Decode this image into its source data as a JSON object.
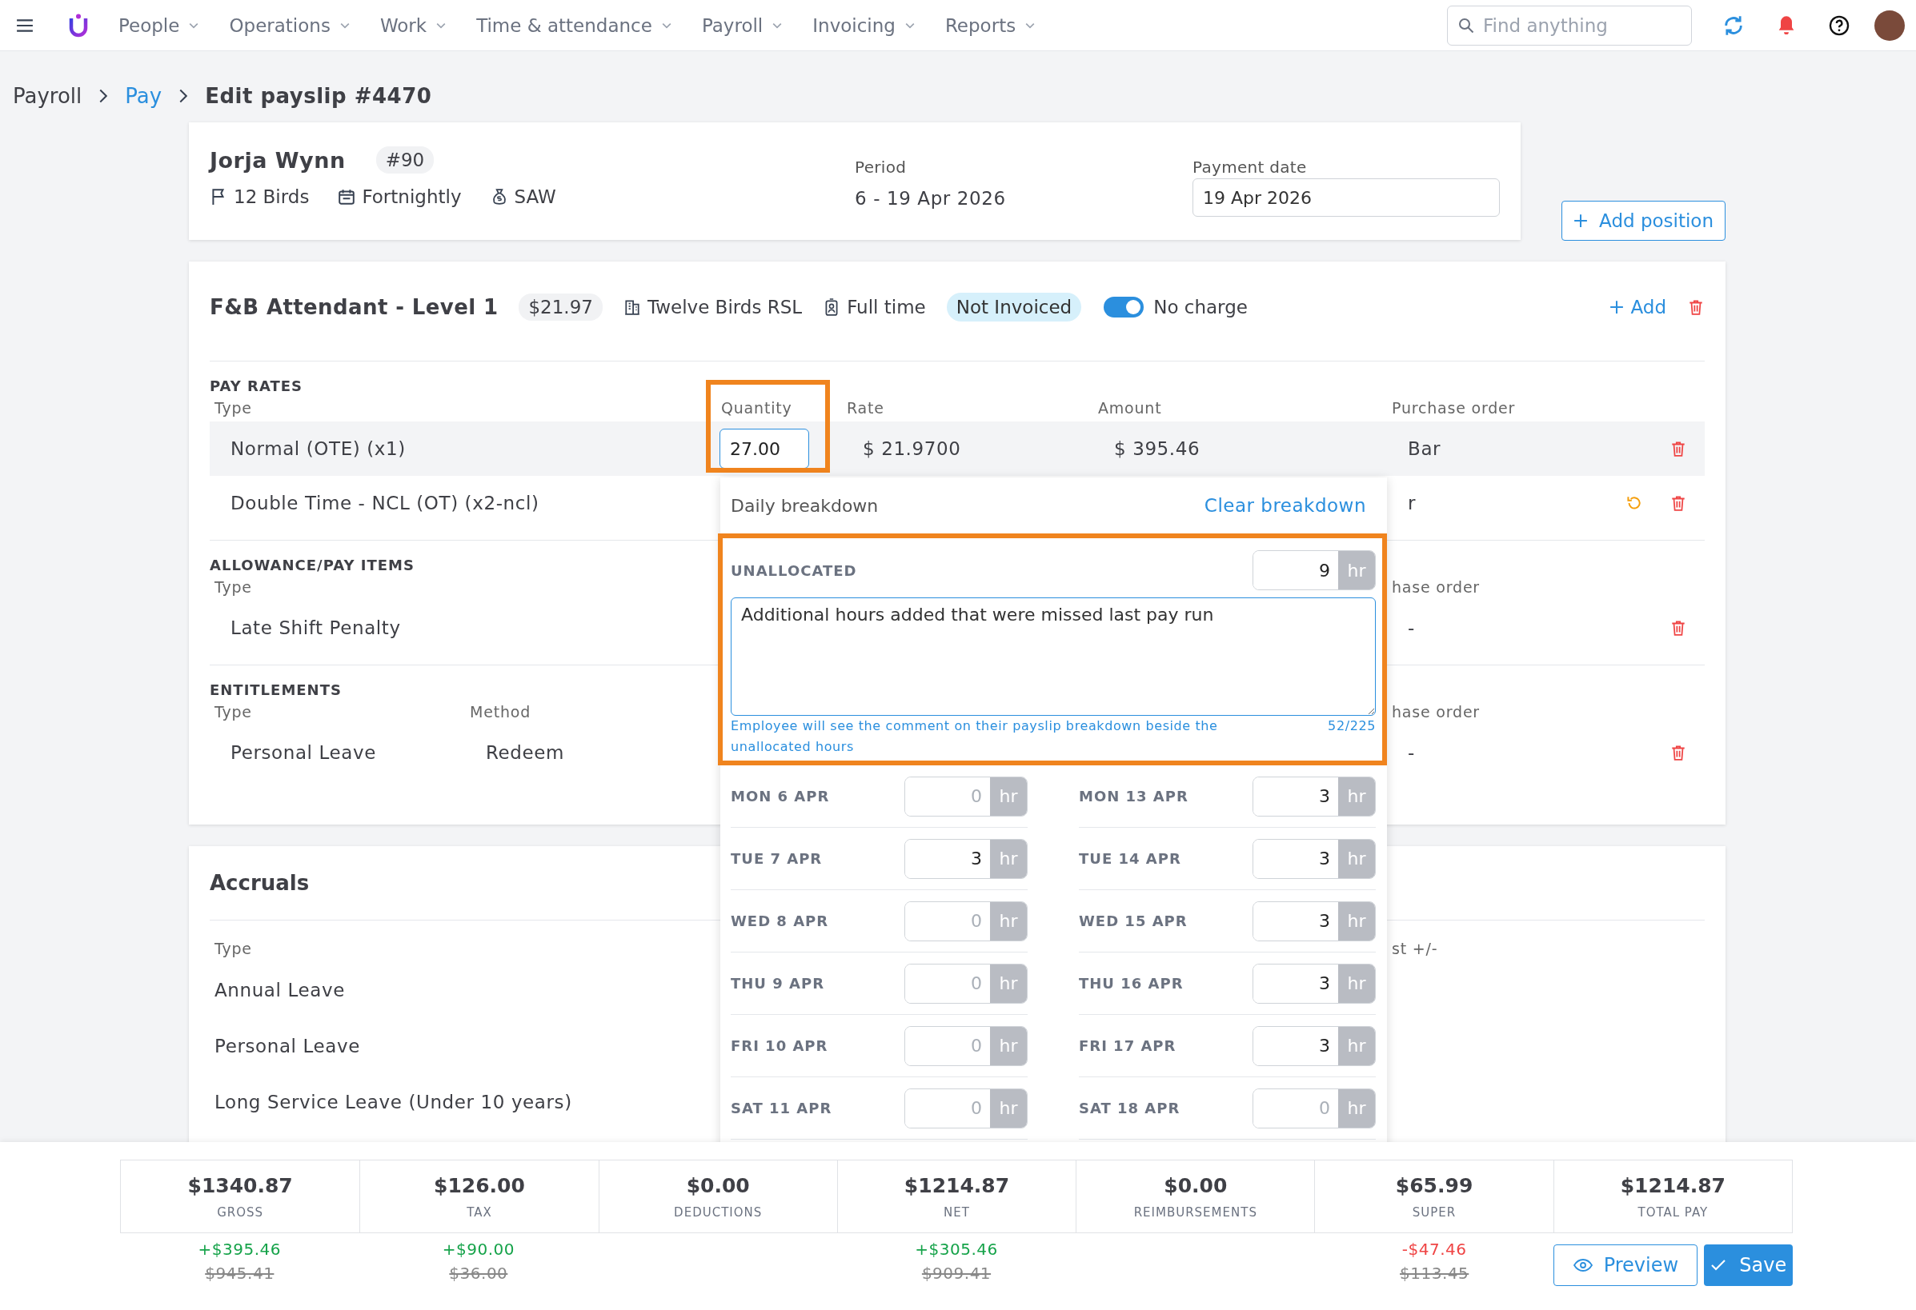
{
  "nav": {
    "items": [
      {
        "label": "People"
      },
      {
        "label": "Operations"
      },
      {
        "label": "Work"
      },
      {
        "label": "Time & attendance"
      },
      {
        "label": "Payroll"
      },
      {
        "label": "Invoicing"
      },
      {
        "label": "Reports"
      }
    ],
    "search": {
      "placeholder": "Find anything"
    }
  },
  "breadcrumb": [
    {
      "label": "Payroll",
      "link": false
    },
    {
      "label": "Pay",
      "link": true
    },
    {
      "label": "Edit payslip #4470",
      "link": false
    }
  ],
  "employee": {
    "name": "Jorja Wynn",
    "number": "#90",
    "details": [
      {
        "kind": "flag",
        "text": "12 Birds"
      },
      {
        "kind": "calendar",
        "text": "Fortnightly"
      },
      {
        "kind": "moneybag",
        "text": "SAW"
      }
    ],
    "period_label": "Period",
    "period": "6 - 19 Apr 2026",
    "payment_date_label": "Payment date",
    "payment_date": "19 Apr 2026"
  },
  "add_position": "Add position",
  "position": {
    "title": "F&B Attendant - Level 1",
    "rate": "$21.97",
    "location": "Twelve Birds RSL",
    "employment": "Full time",
    "invoice_status": "Not Invoiced",
    "no_charge": {
      "label": "No charge",
      "on": true
    },
    "add": "Add"
  },
  "sections": [
    {
      "title": "PAY RATES",
      "columns": [
        {
          "kind": "type",
          "label": "Type"
        },
        {
          "kind": "quantity",
          "label": "Quantity"
        },
        {
          "kind": "rate",
          "label": "Rate"
        },
        {
          "kind": "amount",
          "label": "Amount"
        },
        {
          "kind": "po",
          "label": "Purchase order"
        }
      ],
      "rows": [
        {
          "type": "Normal (OTE) (x1)",
          "quantity": "27.00",
          "rate": "$ 21.9700",
          "amount": "$ 395.46",
          "po": "Bar",
          "highlighted": true,
          "revert": false
        },
        {
          "type": "Double Time - NCL (OT) (x2-ncl)",
          "po": "r",
          "highlighted": false,
          "revert": true
        }
      ]
    },
    {
      "title": "ALLOWANCE/PAY ITEMS",
      "columns": [
        {
          "kind": "type",
          "label": "Type"
        },
        {
          "kind": "po",
          "label": "hase order"
        }
      ],
      "rows": [
        {
          "type": "Late Shift Penalty",
          "po": "-",
          "highlighted": false,
          "revert": false
        }
      ]
    },
    {
      "title": "ENTITLEMENTS",
      "columns": [
        {
          "kind": "type",
          "label": "Type"
        },
        {
          "kind": "method",
          "label": "Method"
        },
        {
          "kind": "po",
          "label": "hase order"
        }
      ],
      "rows": [
        {
          "type": "Personal Leave",
          "method": "Redeem",
          "po": "-",
          "highlighted": false,
          "revert": false
        }
      ]
    }
  ],
  "accruals": {
    "title": "Accruals",
    "columns": [
      {
        "kind": "type",
        "label": "Type"
      },
      {
        "kind": "po",
        "label": "st +/-"
      }
    ],
    "rows": [
      "Annual Leave",
      "Personal Leave",
      "Long Service Leave (Under 10 years)"
    ]
  },
  "breakdown": {
    "title": "Daily breakdown",
    "clear": "Clear breakdown",
    "unallocated": {
      "label": "UNALLOCATED",
      "hours": "9",
      "unit": "hr",
      "comment": "Additional hours added that were missed last pay run",
      "hint": "Employee will see the comment on their payslip breakdown beside the unallocated hours",
      "count": "52/225"
    },
    "days": [
      {
        "label": "MON 6 APR",
        "placeholder": "0",
        "unit": "hr"
      },
      {
        "label": "MON 13 APR",
        "value": "3",
        "unit": "hr"
      },
      {
        "label": "TUE 7 APR",
        "value": "3",
        "unit": "hr"
      },
      {
        "label": "TUE 14 APR",
        "value": "3",
        "unit": "hr"
      },
      {
        "label": "WED 8 APR",
        "placeholder": "0",
        "unit": "hr"
      },
      {
        "label": "WED 15 APR",
        "value": "3",
        "unit": "hr"
      },
      {
        "label": "THU 9 APR",
        "placeholder": "0",
        "unit": "hr"
      },
      {
        "label": "THU 16 APR",
        "value": "3",
        "unit": "hr"
      },
      {
        "label": "FRI 10 APR",
        "placeholder": "0",
        "unit": "hr"
      },
      {
        "label": "FRI 17 APR",
        "value": "3",
        "unit": "hr"
      },
      {
        "label": "SAT 11 APR",
        "placeholder": "0",
        "unit": "hr"
      },
      {
        "label": "SAT 18 APR",
        "placeholder": "0",
        "unit": "hr"
      }
    ]
  },
  "summary": [
    {
      "amount": "$1340.87",
      "label": "GROSS",
      "change": "+$395.46",
      "increase": true,
      "previous": "$945.41"
    },
    {
      "amount": "$126.00",
      "label": "TAX",
      "change": "+$90.00",
      "increase": true,
      "previous": "$36.00"
    },
    {
      "amount": "$0.00",
      "label": "DEDUCTIONS"
    },
    {
      "amount": "$1214.87",
      "label": "NET",
      "change": "+$305.46",
      "increase": true,
      "previous": "$909.41"
    },
    {
      "amount": "$0.00",
      "label": "REIMBURSEMENTS"
    },
    {
      "amount": "$65.99",
      "label": "SUPER",
      "change": "-$47.46",
      "increase": false,
      "previous": "$113.45"
    },
    {
      "amount": "$1214.87",
      "label": "TOTAL PAY"
    }
  ],
  "buttons": {
    "preview": "Preview",
    "save": "Save"
  }
}
